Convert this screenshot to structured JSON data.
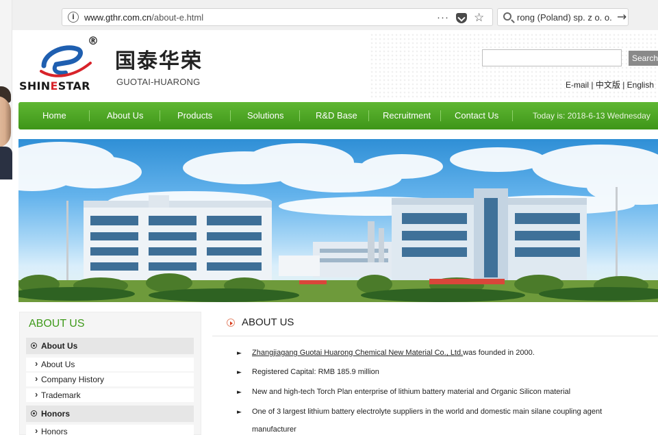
{
  "browser": {
    "url_host": "www.gthr.com.cn",
    "url_path": "/about-e.html",
    "search_text": "rong (Poland) sp. z o. o.",
    "icons": [
      "info-icon",
      "more-dots-icon",
      "pocket-icon",
      "bookmark-star-icon",
      "search-icon",
      "arrow-right-icon"
    ]
  },
  "header": {
    "logo_brand_left": "SHIN",
    "logo_brand_mid": "E",
    "logo_brand_right": "STAR",
    "registered_mark": "®",
    "chinese_name": "国泰华荣",
    "english_name": "GUOTAI-HUARONG",
    "search_button": "Search",
    "search_placeholder": "",
    "links": [
      "E-mail",
      "中文版",
      "English"
    ],
    "link_sep": "|"
  },
  "nav": {
    "items": [
      "Home",
      "About Us",
      "Products",
      "Solutions",
      "R&D Base",
      "Recruitment",
      "Contact Us"
    ],
    "date": "Today is: 2018-6-13 Wednesday"
  },
  "sidebar": {
    "title": "ABOUT US",
    "sections": [
      {
        "head": "About Us",
        "items": [
          "About Us",
          "Company History",
          "Trademark"
        ]
      },
      {
        "head": "Honors",
        "items": [
          "Honors"
        ]
      }
    ]
  },
  "main": {
    "title": "ABOUT US",
    "items": [
      {
        "link": "Zhangjiagang Guotai Huarong Chemical New Material Co., Ltd.",
        "text": "was founded in 2000."
      },
      {
        "link": "",
        "text": "Registered Capital: RMB 185.9 million"
      },
      {
        "link": "",
        "text": "New and high-tech Torch Plan enterprise of lithium battery material and Organic Silicon material"
      },
      {
        "link": "",
        "text": "One of 3 largest lithium battery electrolyte suppliers in the world and domestic main silane coupling agent"
      },
      {
        "link": "",
        "text": "manufacturer"
      }
    ]
  },
  "colors": {
    "nav_green": "#4ea525",
    "sidebar_title": "#3f9a1b",
    "logo_red": "#d8232a",
    "logo_blue": "#1f5fb0"
  }
}
